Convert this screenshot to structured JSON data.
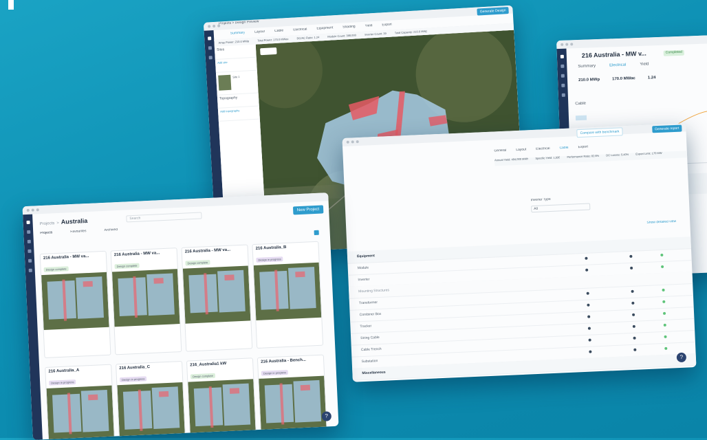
{
  "map_window": {
    "breadcrumb": "Projects > Design Preview",
    "tabs": [
      "Summary",
      "Layout",
      "Cable",
      "Electrical",
      "Equipment",
      "Shading",
      "Yield",
      "Export"
    ],
    "stats": [
      "Array Power: 210.0 MWp",
      "Total Power: 170.0 MWac",
      "DC/AC Ratio: 1.24",
      "Module Count: 388,000",
      "Inverter Count: 39",
      "Total Capacity: 210.0 MWp"
    ],
    "side_labels": [
      "Sites",
      "Add site",
      "Site 1",
      "Topography",
      "Add topography"
    ],
    "button": "Generate Design",
    "help_label": "?"
  },
  "back_window": {
    "title": "216 Australia - MW v...",
    "status_badge": "Completed",
    "tabs": [
      "Summary",
      "Electrical",
      "Yield"
    ],
    "stats": [
      "210.0 MWp",
      "170.0 MWac",
      "1.24"
    ],
    "section": "Cable"
  },
  "table_window": {
    "tabs": [
      "General",
      "Layout",
      "Electrical",
      "Cable",
      "Export"
    ],
    "stats": [
      "Annual Yield: 404,000 MWh",
      "Specific Yield: 1,930",
      "Performance Ratio: 82.6%",
      "DC Losses: 5.40%",
      "Export Limit: 170 MW"
    ],
    "buttons": [
      "Compare with benchmark",
      "Generate report"
    ],
    "dropdown_label": "Inverter Type",
    "dropdown_value": "All",
    "section_1": "Equipment",
    "section_2": "Mounting Structures",
    "section_footer": "Miscellaneous",
    "link": "Show detailed view",
    "rows": [
      "Module",
      "Inverter",
      "Transformer",
      "Combiner Box",
      "Tracker",
      "String Cable",
      "Cable Trench",
      "Substation"
    ]
  },
  "projects_window": {
    "breadcrumb_parent": "Projects",
    "breadcrumb_current": "Australia",
    "search_placeholder": "Search",
    "new_button": "New Project",
    "tabs": [
      "Projects",
      "Favourites",
      "Archived"
    ],
    "help_label": "?",
    "cards": [
      {
        "title": "216 Australia - MW va...",
        "tag": "Design complete",
        "tag_color": "#dcefdc"
      },
      {
        "title": "216 Australia - MW va...",
        "tag": "Design complete",
        "tag_color": "#dcefdc"
      },
      {
        "title": "216 Australia - MW va...",
        "tag": "Design complete",
        "tag_color": "#dcefdc"
      },
      {
        "title": "216 Australia_B",
        "tag": "Design in progress",
        "tag_color": "#e6dcf2"
      },
      {
        "title": "216 Australia_A",
        "tag": "Design in progress",
        "tag_color": "#e6dcf2"
      },
      {
        "title": "216 Australia_C",
        "tag": "Design in progress",
        "tag_color": "#e6dcf2"
      },
      {
        "title": "216_Australia1 kW",
        "tag": "Design complete",
        "tag_color": "#dcefdc"
      },
      {
        "title": "216 Australia - Bench...",
        "tag": "Design in progress",
        "tag_color": "#e6dcf2"
      }
    ]
  },
  "colors": {
    "background": "#0d8fb3",
    "accent": "#2e9ccd",
    "navrail": "#20355a"
  }
}
